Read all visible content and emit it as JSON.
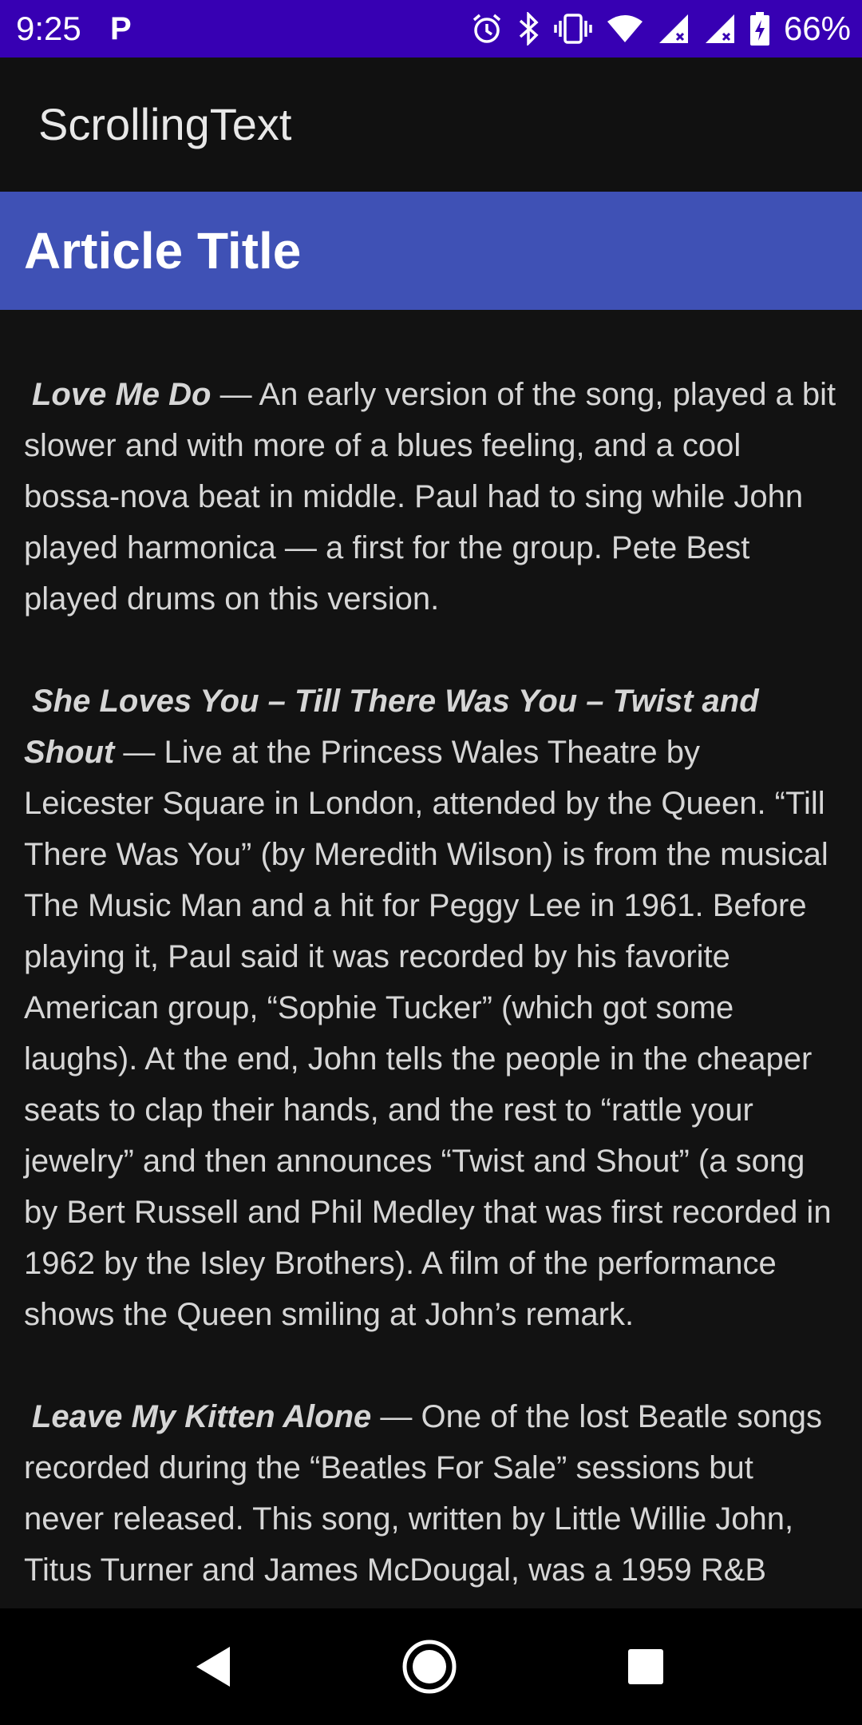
{
  "status_bar": {
    "time": "9:25",
    "app_badge": "P",
    "battery_percent": "66%",
    "icons": [
      "alarm-icon",
      "bluetooth-icon",
      "vibrate-icon",
      "wifi-icon",
      "signal-icon",
      "signal-icon",
      "battery-charging-icon"
    ]
  },
  "app_bar": {
    "title": "ScrollingText"
  },
  "article": {
    "title": "Article Title",
    "paragraphs": [
      {
        "song": "Love Me Do",
        "text": " — An early version of the song, played a bit slower and with more of a blues feeling, and a cool bossa-nova beat in middle. Paul had to sing while John played harmonica — a first for the group. Pete Best played drums on this version."
      },
      {
        "song": "She Loves You – Till There Was You – Twist and Shout",
        "text": " — Live at the Princess Wales Theatre by Leicester Square in London, attended by the Queen. “Till There Was You” (by Meredith Wilson) is from the musical The Music Man and a hit for Peggy Lee in 1961. Before playing it, Paul said it was recorded by his favorite American group, “Sophie Tucker” (which got some laughs). At the end, John tells the people in the cheaper seats to clap their hands, and the rest to “rattle your jewelry” and then announces “Twist and Shout” (a song by Bert Russell and Phil Medley that was first recorded in 1962 by the Isley Brothers). A film of the performance shows the Queen smiling at John’s remark."
      },
      {
        "song": "Leave My Kitten Alone",
        "text": " — One of the lost Beatle songs recorded during the “Beatles For Sale” sessions but never released. This song, written by Little Willie John, Titus Turner and James McDougal, was a 1959 R&B"
      }
    ]
  },
  "nav_bar": {
    "buttons": [
      "back-icon",
      "home-icon",
      "recents-icon"
    ]
  },
  "colors": {
    "status_bar": "#3700b3",
    "app_bar": "#111111",
    "article_header": "#3f51b5",
    "background": "#121212",
    "body_text": "#d6d6d6"
  }
}
